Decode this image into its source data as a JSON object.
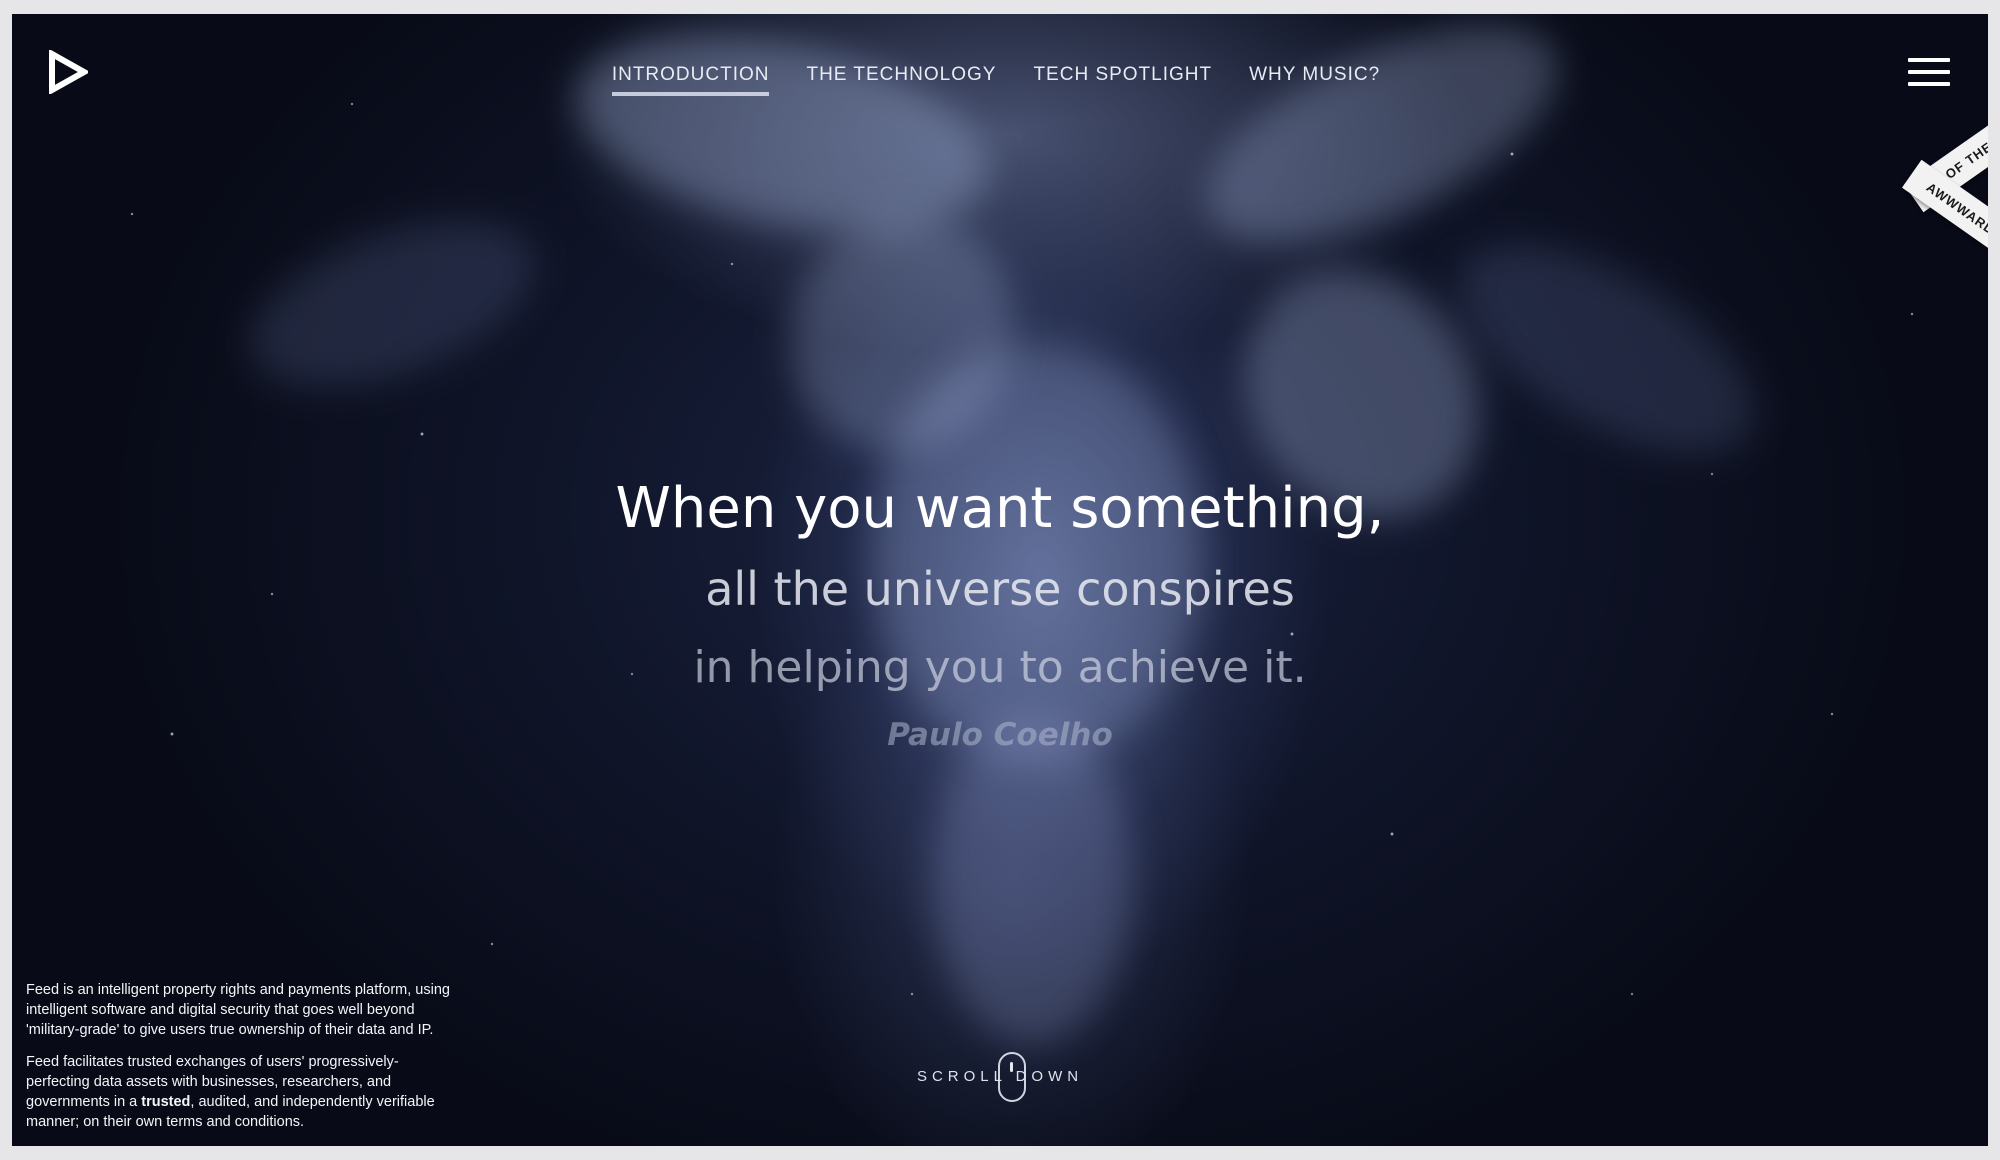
{
  "nav": {
    "items": [
      {
        "label": "INTRODUCTION",
        "active": true
      },
      {
        "label": "THE TECHNOLOGY",
        "active": false
      },
      {
        "label": "TECH SPOTLIGHT",
        "active": false
      },
      {
        "label": "WHY MUSIC?",
        "active": false
      }
    ]
  },
  "icons": {
    "logo": "play-triangle-logo-icon",
    "menu": "hamburger-menu-icon",
    "scroll": "mouse-scroll-icon"
  },
  "badge": {
    "line1": "SITE OF THE DAY",
    "line2": "AWWWARDS"
  },
  "quote": {
    "line1": "When you want something,",
    "line2": "all the universe conspires",
    "line3": "in helping you to achieve it.",
    "author": "Paulo Coelho"
  },
  "about": {
    "p1": "Feed is an intelligent property rights and payments platform, using intelligent software and digital security that goes well beyond 'military-grade' to give users true ownership of their data and IP.",
    "p2_before": "Feed facilitates trusted exchanges of users' progressively-perfecting data assets with businesses, researchers, and governments in a ",
    "p2_bold": "trusted",
    "p2_after": ", audited, and independently verifiable manner; on their own terms and conditions."
  },
  "scroll_label": "SCROLL DOWN",
  "colors": {
    "background_dark": "#0f1428",
    "smoke": "#aab9e1",
    "text": "#ffffff"
  }
}
